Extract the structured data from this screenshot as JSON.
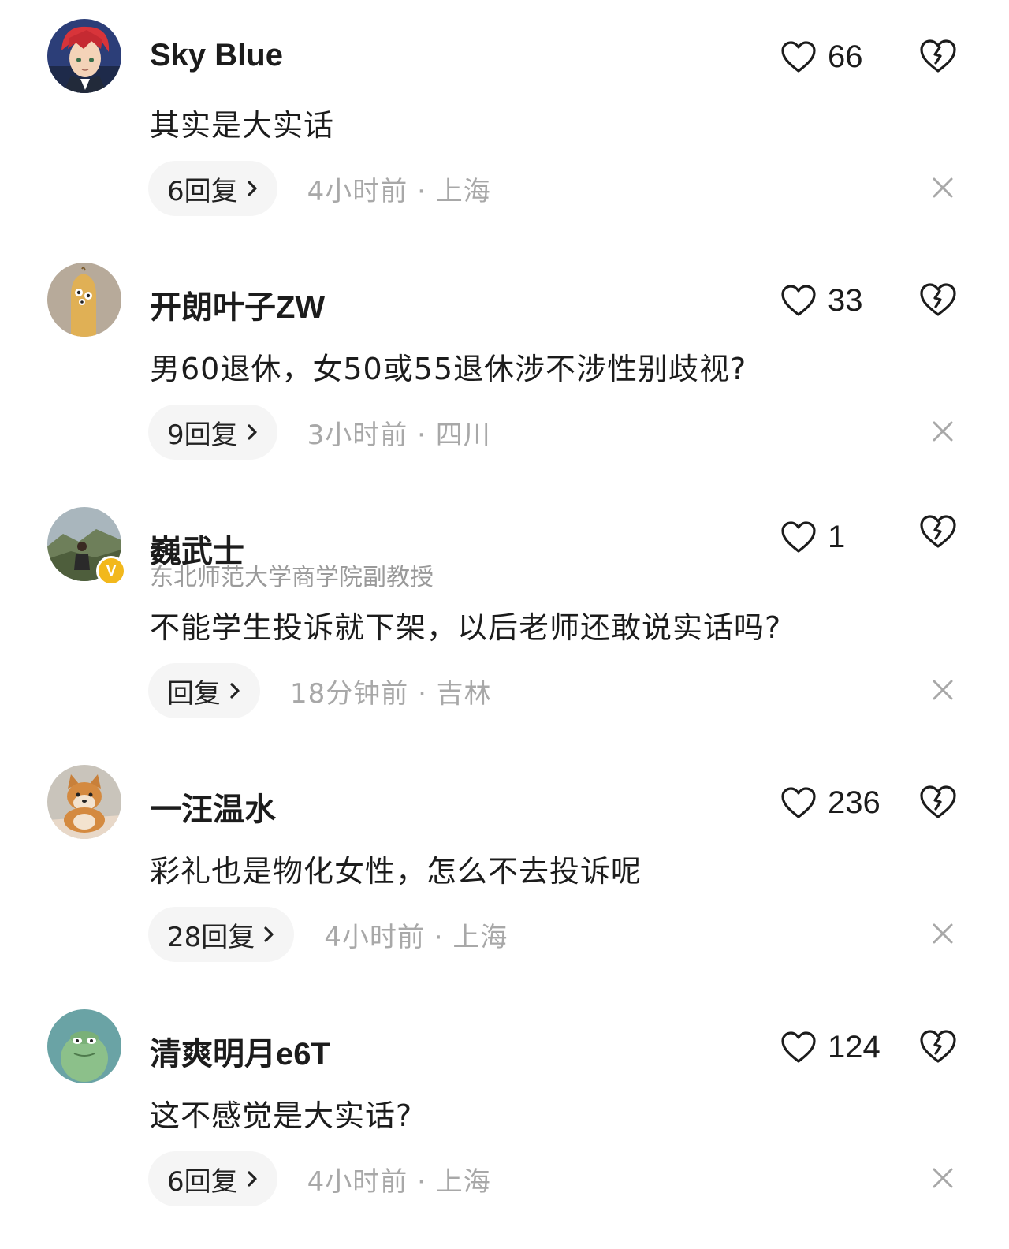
{
  "comments": [
    {
      "username": "Sky Blue",
      "title": "",
      "content": "其实是大实话",
      "likes": "66",
      "reply_label": "6回复",
      "meta": "4小时前 · 上海",
      "verified": false,
      "avatar": "anime-character-avatar"
    },
    {
      "username": "开朗叶子ZW",
      "title": "",
      "content": "男60退休，女50或55退休涉不涉性别歧视?",
      "likes": "33",
      "reply_label": "9回复",
      "meta": "3小时前 · 四川",
      "verified": false,
      "avatar": "cartoon-figure-avatar"
    },
    {
      "username": "巍武士",
      "title": "东北师范大学商学院副教授",
      "content": "不能学生投诉就下架，以后老师还敢说实话吗?",
      "likes": "1",
      "reply_label": "回复",
      "meta": "18分钟前 · 吉林",
      "verified": true,
      "avatar": "person-landscape-avatar"
    },
    {
      "username": "一汪温水",
      "title": "",
      "content": "彩礼也是物化女性，怎么不去投诉呢",
      "likes": "236",
      "reply_label": "28回复",
      "meta": "4小时前 · 上海",
      "verified": false,
      "avatar": "shiba-dog-avatar"
    },
    {
      "username": "清爽明月e6T",
      "title": "",
      "content": "这不感觉是大实话?",
      "likes": "124",
      "reply_label": "6回复",
      "meta": "4小时前 · 上海",
      "verified": false,
      "avatar": "green-cartoon-avatar"
    }
  ],
  "icons": {
    "like": "heart-outline-icon",
    "dislike": "broken-heart-icon",
    "reply": "chevron-right-icon",
    "close": "close-icon",
    "verified": "verified-v-badge-icon"
  },
  "verified_badge_text": "V",
  "colors": {
    "meta_text": "#a8a8a8",
    "pill_bg": "#f5f5f5",
    "verified_badge": "#f2b81c",
    "primary_text": "#1c1c1c"
  }
}
